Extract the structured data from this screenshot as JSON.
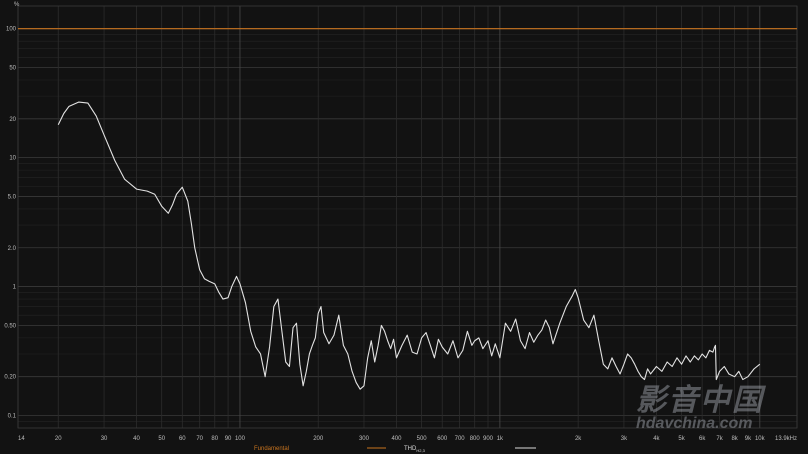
{
  "chart_data": {
    "type": "line",
    "title": "",
    "xlabel": "",
    "ylabel": "%",
    "x_scale": "log",
    "y_scale": "log",
    "xlim": [
      14,
      13900
    ],
    "ylim": [
      0.08,
      150
    ],
    "grid": true,
    "x_ticks": [
      {
        "v": 14,
        "label": "14"
      },
      {
        "v": 20,
        "label": "20"
      },
      {
        "v": 30,
        "label": "30"
      },
      {
        "v": 40,
        "label": "40"
      },
      {
        "v": 50,
        "label": "50"
      },
      {
        "v": 60,
        "label": "60"
      },
      {
        "v": 70,
        "label": "70"
      },
      {
        "v": 80,
        "label": "80"
      },
      {
        "v": 90,
        "label": "90"
      },
      {
        "v": 100,
        "label": "100"
      },
      {
        "v": 200,
        "label": "200"
      },
      {
        "v": 300,
        "label": "300"
      },
      {
        "v": 400,
        "label": "400"
      },
      {
        "v": 500,
        "label": "500"
      },
      {
        "v": 600,
        "label": "600"
      },
      {
        "v": 700,
        "label": "700"
      },
      {
        "v": 800,
        "label": "800"
      },
      {
        "v": 900,
        "label": "900"
      },
      {
        "v": 1000,
        "label": "1k"
      },
      {
        "v": 2000,
        "label": "2k"
      },
      {
        "v": 3000,
        "label": "3k"
      },
      {
        "v": 4000,
        "label": "4k"
      },
      {
        "v": 5000,
        "label": "5k"
      },
      {
        "v": 6000,
        "label": "6k"
      },
      {
        "v": 7000,
        "label": "7k"
      },
      {
        "v": 8000,
        "label": "8k"
      },
      {
        "v": 9000,
        "label": "9k"
      },
      {
        "v": 10000,
        "label": "10k"
      },
      {
        "v": 13900,
        "label": "13.9kHz"
      }
    ],
    "y_ticks": [
      {
        "v": 0.1,
        "label": "0.1"
      },
      {
        "v": 0.2,
        "label": "0.20"
      },
      {
        "v": 0.5,
        "label": "0.50"
      },
      {
        "v": 1,
        "label": "1"
      },
      {
        "v": 2,
        "label": "2.0"
      },
      {
        "v": 5,
        "label": "5.0"
      },
      {
        "v": 10,
        "label": "10"
      },
      {
        "v": 20,
        "label": "20"
      },
      {
        "v": 50,
        "label": "50"
      },
      {
        "v": 100,
        "label": "100"
      }
    ],
    "legend": [
      {
        "label": "Fundamental",
        "color": "#c8741f"
      },
      {
        "label_main": "THD",
        "label_sub": "H2,3",
        "color": "#d9d9d9"
      }
    ],
    "series": [
      {
        "color": "#c8741f",
        "x": [
          14,
          13900
        ],
        "y": [
          100,
          100
        ]
      },
      {
        "color": "#e2e2e2",
        "x": [
          20,
          21,
          22,
          24,
          26,
          28,
          30,
          33,
          36,
          40,
          44,
          47,
          50,
          53,
          55,
          57,
          60,
          63,
          65,
          67,
          70,
          73,
          76,
          80,
          83,
          86,
          90,
          93,
          97,
          100,
          105,
          110,
          115,
          120,
          125,
          130,
          135,
          140,
          145,
          150,
          155,
          160,
          165,
          170,
          175,
          180,
          185,
          190,
          195,
          200,
          205,
          210,
          220,
          230,
          240,
          250,
          260,
          270,
          280,
          290,
          300,
          310,
          320,
          330,
          340,
          350,
          360,
          370,
          380,
          390,
          400,
          420,
          440,
          460,
          480,
          500,
          520,
          540,
          560,
          580,
          600,
          630,
          660,
          690,
          720,
          750,
          780,
          800,
          830,
          860,
          900,
          930,
          960,
          1000,
          1050,
          1100,
          1150,
          1200,
          1250,
          1300,
          1350,
          1400,
          1450,
          1500,
          1550,
          1600,
          1700,
          1800,
          1900,
          1950,
          2000,
          2100,
          2200,
          2300,
          2400,
          2500,
          2600,
          2700,
          2800,
          2900,
          3000,
          3100,
          3200,
          3300,
          3400,
          3500,
          3600,
          3700,
          3800,
          4000,
          4200,
          4400,
          4600,
          4800,
          5000,
          5200,
          5400,
          5600,
          5800,
          6000,
          6200,
          6400,
          6600,
          6700,
          6750,
          6800,
          7000,
          7300,
          7600,
          8000,
          8300,
          8600,
          9000,
          9500,
          10000
        ],
        "y": [
          18,
          22,
          25,
          27,
          26.5,
          21,
          15,
          9.5,
          6.8,
          5.7,
          5.5,
          5.2,
          4.2,
          3.7,
          4.3,
          5.2,
          5.9,
          4.6,
          3.1,
          2.0,
          1.35,
          1.15,
          1.1,
          1.05,
          0.9,
          0.8,
          0.82,
          1.0,
          1.2,
          1.05,
          0.75,
          0.45,
          0.34,
          0.3,
          0.2,
          0.34,
          0.7,
          0.8,
          0.45,
          0.26,
          0.24,
          0.48,
          0.52,
          0.25,
          0.17,
          0.22,
          0.3,
          0.35,
          0.4,
          0.62,
          0.7,
          0.44,
          0.36,
          0.42,
          0.6,
          0.35,
          0.3,
          0.22,
          0.18,
          0.16,
          0.17,
          0.28,
          0.38,
          0.26,
          0.35,
          0.5,
          0.45,
          0.38,
          0.33,
          0.39,
          0.28,
          0.35,
          0.42,
          0.31,
          0.3,
          0.4,
          0.44,
          0.35,
          0.28,
          0.39,
          0.34,
          0.3,
          0.38,
          0.28,
          0.32,
          0.45,
          0.35,
          0.38,
          0.4,
          0.33,
          0.38,
          0.29,
          0.36,
          0.28,
          0.52,
          0.45,
          0.56,
          0.38,
          0.33,
          0.44,
          0.37,
          0.42,
          0.46,
          0.55,
          0.48,
          0.36,
          0.52,
          0.7,
          0.85,
          0.95,
          0.82,
          0.55,
          0.48,
          0.6,
          0.38,
          0.25,
          0.23,
          0.28,
          0.24,
          0.21,
          0.25,
          0.3,
          0.28,
          0.25,
          0.22,
          0.2,
          0.19,
          0.23,
          0.21,
          0.24,
          0.22,
          0.26,
          0.24,
          0.28,
          0.25,
          0.29,
          0.26,
          0.29,
          0.27,
          0.3,
          0.28,
          0.32,
          0.31,
          0.34,
          0.35,
          0.19,
          0.22,
          0.24,
          0.21,
          0.2,
          0.22,
          0.19,
          0.2,
          0.23,
          0.25
        ]
      }
    ]
  },
  "watermark": {
    "main": "影音中国",
    "sub": "hdavchina.com"
  }
}
